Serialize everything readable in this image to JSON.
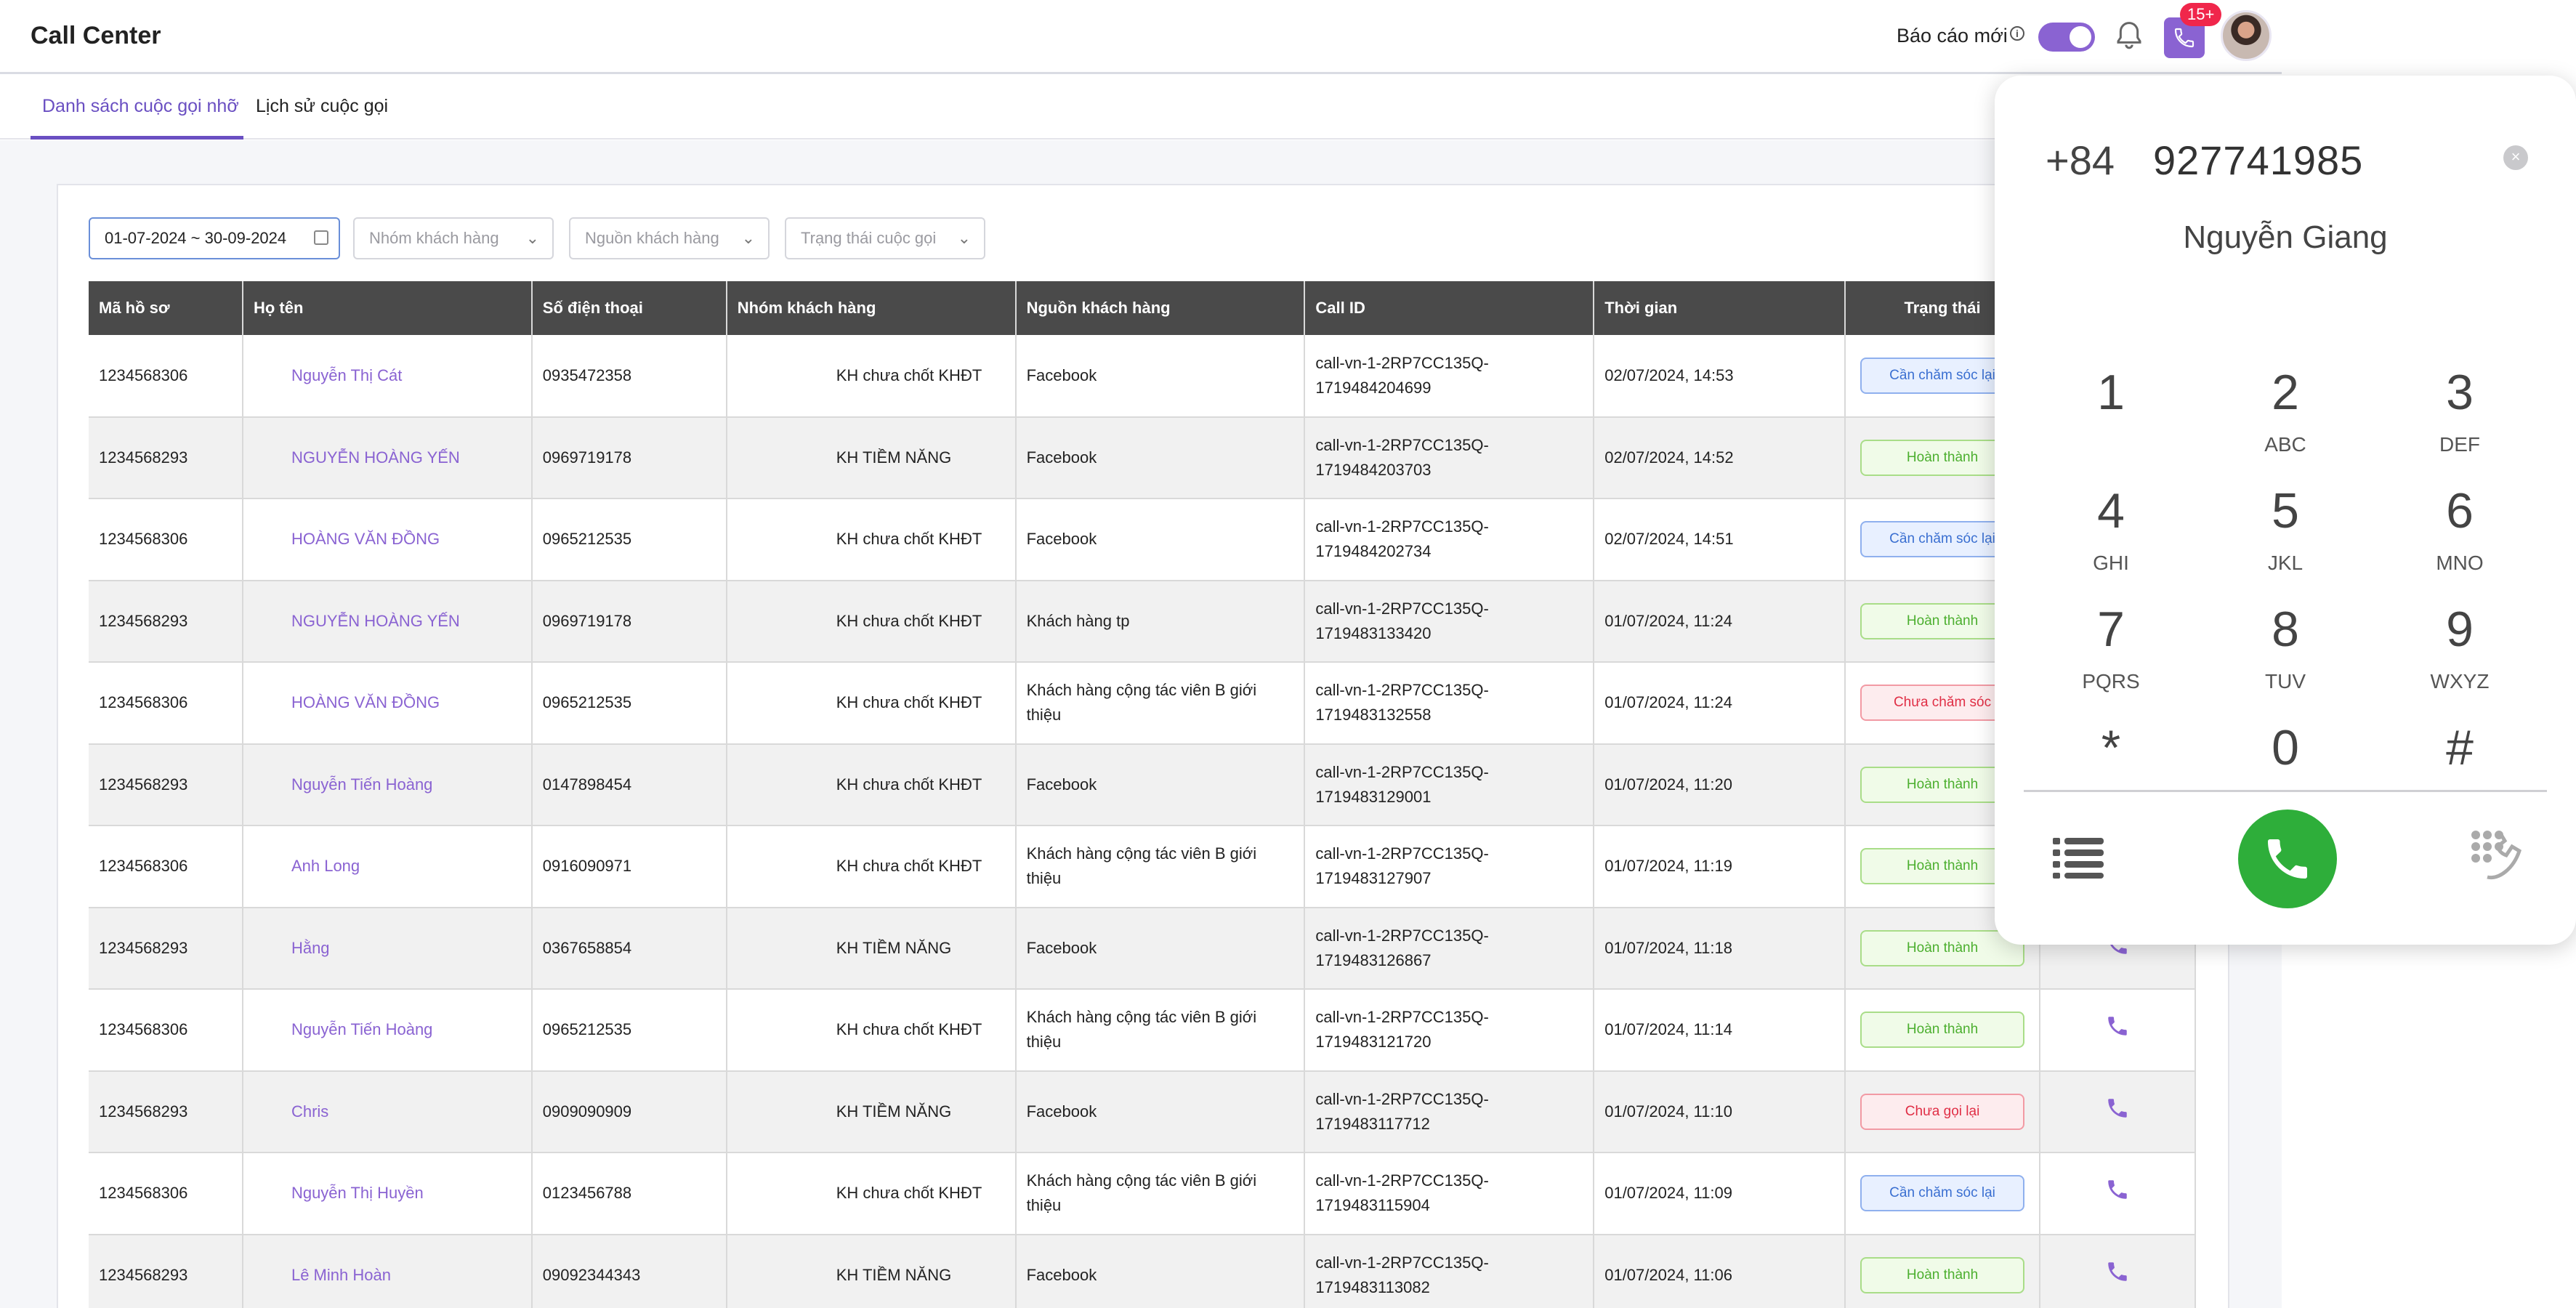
{
  "header": {
    "app_title": "Call Center",
    "report_label": "Báo cáo mới",
    "report_toggle_on": true,
    "call_badge_count": "15+"
  },
  "tabs": [
    {
      "label": "Danh sách cuộc gọi nhỡ",
      "active": true
    },
    {
      "label": "Lịch sử cuộc gọi",
      "active": false
    }
  ],
  "filters": {
    "date_range": "01-07-2024 ~ 30-09-2024",
    "customer_group_placeholder": "Nhóm khách hàng",
    "customer_source_placeholder": "Nguồn khách hàng",
    "call_status_placeholder": "Trạng thái cuộc gọi"
  },
  "table": {
    "columns": [
      "Mã hồ sơ",
      "Họ tên",
      "Số điện thoại",
      "Nhóm khách hàng",
      "Nguồn khách hàng",
      "Call ID",
      "Thời gian",
      "Trạng thái"
    ],
    "rows": [
      {
        "code": "1234568306",
        "name": "Nguyễn Thị Cát",
        "phone": "0935472358",
        "group": "KH chưa chốt KHĐT",
        "source": "Facebook",
        "call_id_1": "call-vn-1-2RP7CC135Q-",
        "call_id_2": "1719484204699",
        "time": "02/07/2024, 14:53",
        "status": "Cần chăm sóc lại",
        "status_type": "blue"
      },
      {
        "code": "1234568293",
        "name": "NGUYỄN HOÀNG YẾN",
        "phone": "0969719178",
        "group": "KH TIỀM NĂNG",
        "source": "Facebook",
        "call_id_1": "call-vn-1-2RP7CC135Q-",
        "call_id_2": "1719484203703",
        "time": "02/07/2024, 14:52",
        "status": "Hoàn thành",
        "status_type": "green"
      },
      {
        "code": "1234568306",
        "name": "HOÀNG VĂN ĐỒNG",
        "phone": "0965212535",
        "group": "KH chưa chốt KHĐT",
        "source": "Facebook",
        "call_id_1": "call-vn-1-2RP7CC135Q-",
        "call_id_2": "1719484202734",
        "time": "02/07/2024, 14:51",
        "status": "Cần chăm sóc lại",
        "status_type": "blue"
      },
      {
        "code": "1234568293",
        "name": "NGUYỄN HOÀNG YẾN",
        "phone": "0969719178",
        "group": "KH chưa chốt KHĐT",
        "source": "Khách hàng tp",
        "call_id_1": "call-vn-1-2RP7CC135Q-",
        "call_id_2": "1719483133420",
        "time": "01/07/2024, 11:24",
        "status": "Hoàn thành",
        "status_type": "green"
      },
      {
        "code": "1234568306",
        "name": "HOÀNG VĂN ĐỒNG",
        "phone": "0965212535",
        "group": "KH chưa chốt KHĐT",
        "source": "Khách hàng cộng tác viên B giới thiệu",
        "call_id_1": "call-vn-1-2RP7CC135Q-",
        "call_id_2": "1719483132558",
        "time": "01/07/2024, 11:24",
        "status": "Chưa chăm sóc",
        "status_type": "red"
      },
      {
        "code": "1234568293",
        "name": "Nguyễn Tiến Hoàng",
        "phone": "0147898454",
        "group": "KH chưa chốt KHĐT",
        "source": "Facebook",
        "call_id_1": "call-vn-1-2RP7CC135Q-",
        "call_id_2": "1719483129001",
        "time": "01/07/2024, 11:20",
        "status": "Hoàn thành",
        "status_type": "green"
      },
      {
        "code": "1234568306",
        "name": "Anh Long",
        "phone": "0916090971",
        "group": "KH chưa chốt KHĐT",
        "source": "Khách hàng cộng tác viên B giới thiệu",
        "call_id_1": "call-vn-1-2RP7CC135Q-",
        "call_id_2": "1719483127907",
        "time": "01/07/2024, 11:19",
        "status": "Hoàn thành",
        "status_type": "green"
      },
      {
        "code": "1234568293",
        "name": "Hằng",
        "phone": "0367658854",
        "group": "KH TIỀM NĂNG",
        "source": "Facebook",
        "call_id_1": "call-vn-1-2RP7CC135Q-",
        "call_id_2": "1719483126867",
        "time": "01/07/2024, 11:18",
        "status": "Hoàn thành",
        "status_type": "green"
      },
      {
        "code": "1234568306",
        "name": "Nguyễn Tiến Hoàng",
        "phone": "0965212535",
        "group": "KH chưa chốt KHĐT",
        "source": "Khách hàng cộng tác viên B giới thiệu",
        "call_id_1": "call-vn-1-2RP7CC135Q-",
        "call_id_2": "1719483121720",
        "time": "01/07/2024, 11:14",
        "status": "Hoàn thành",
        "status_type": "green"
      },
      {
        "code": "1234568293",
        "name": "Chris",
        "phone": "0909090909",
        "group": "KH TIỀM NĂNG",
        "source": "Facebook",
        "call_id_1": "call-vn-1-2RP7CC135Q-",
        "call_id_2": "1719483117712",
        "time": "01/07/2024, 11:10",
        "status": "Chưa gọi lại",
        "status_type": "red"
      },
      {
        "code": "1234568306",
        "name": "Nguyễn Thị Huyền",
        "phone": "0123456788",
        "group": "KH chưa chốt KHĐT",
        "source": "Khách hàng cộng tác viên B giới thiệu",
        "call_id_1": "call-vn-1-2RP7CC135Q-",
        "call_id_2": "1719483115904",
        "time": "01/07/2024, 11:09",
        "status": "Cần chăm sóc lại",
        "status_type": "blue"
      },
      {
        "code": "1234568293",
        "name": "Lê Minh Hoàn",
        "phone": "09092344343",
        "group": "KH TIỀM NĂNG",
        "source": "Facebook",
        "call_id_1": "call-vn-1-2RP7CC135Q-",
        "call_id_2": "1719483113082",
        "time": "01/07/2024, 11:06",
        "status": "Hoàn thành",
        "status_type": "green"
      }
    ]
  },
  "dialer": {
    "country_code": "+84",
    "number": "927741985",
    "contact_name": "Nguyễn Giang",
    "keys": [
      {
        "digit": "1",
        "letters": ""
      },
      {
        "digit": "2",
        "letters": "ABC"
      },
      {
        "digit": "3",
        "letters": "DEF"
      },
      {
        "digit": "4",
        "letters": "GHI"
      },
      {
        "digit": "5",
        "letters": "JKL"
      },
      {
        "digit": "6",
        "letters": "MNO"
      },
      {
        "digit": "7",
        "letters": "PQRS"
      },
      {
        "digit": "8",
        "letters": "TUV"
      },
      {
        "digit": "9",
        "letters": "WXYZ"
      },
      {
        "digit": "*",
        "letters": ""
      },
      {
        "digit": "0",
        "letters": ""
      },
      {
        "digit": "#",
        "letters": ""
      }
    ],
    "colors": {
      "call_button": "#2eae3a",
      "accent": "#8a63d2"
    }
  }
}
